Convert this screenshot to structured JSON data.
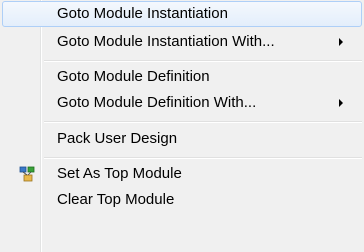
{
  "menu": {
    "items": [
      {
        "label": "Goto Module Instantiation"
      },
      {
        "label": "Goto Module Instantiation With..."
      },
      {
        "label": "Goto Module Definition"
      },
      {
        "label": "Goto Module Definition With..."
      },
      {
        "label": "Pack User Design"
      },
      {
        "label": "Set As Top Module",
        "icon": "module-hierarchy-icon"
      },
      {
        "label": "Clear Top Module"
      }
    ]
  },
  "colors": {
    "background": "#f0f0f0",
    "highlight_border": "#aecff7",
    "highlight_fill": "#e3eefb",
    "icon_green": "#3aa23a",
    "icon_blue": "#3a78c8"
  }
}
